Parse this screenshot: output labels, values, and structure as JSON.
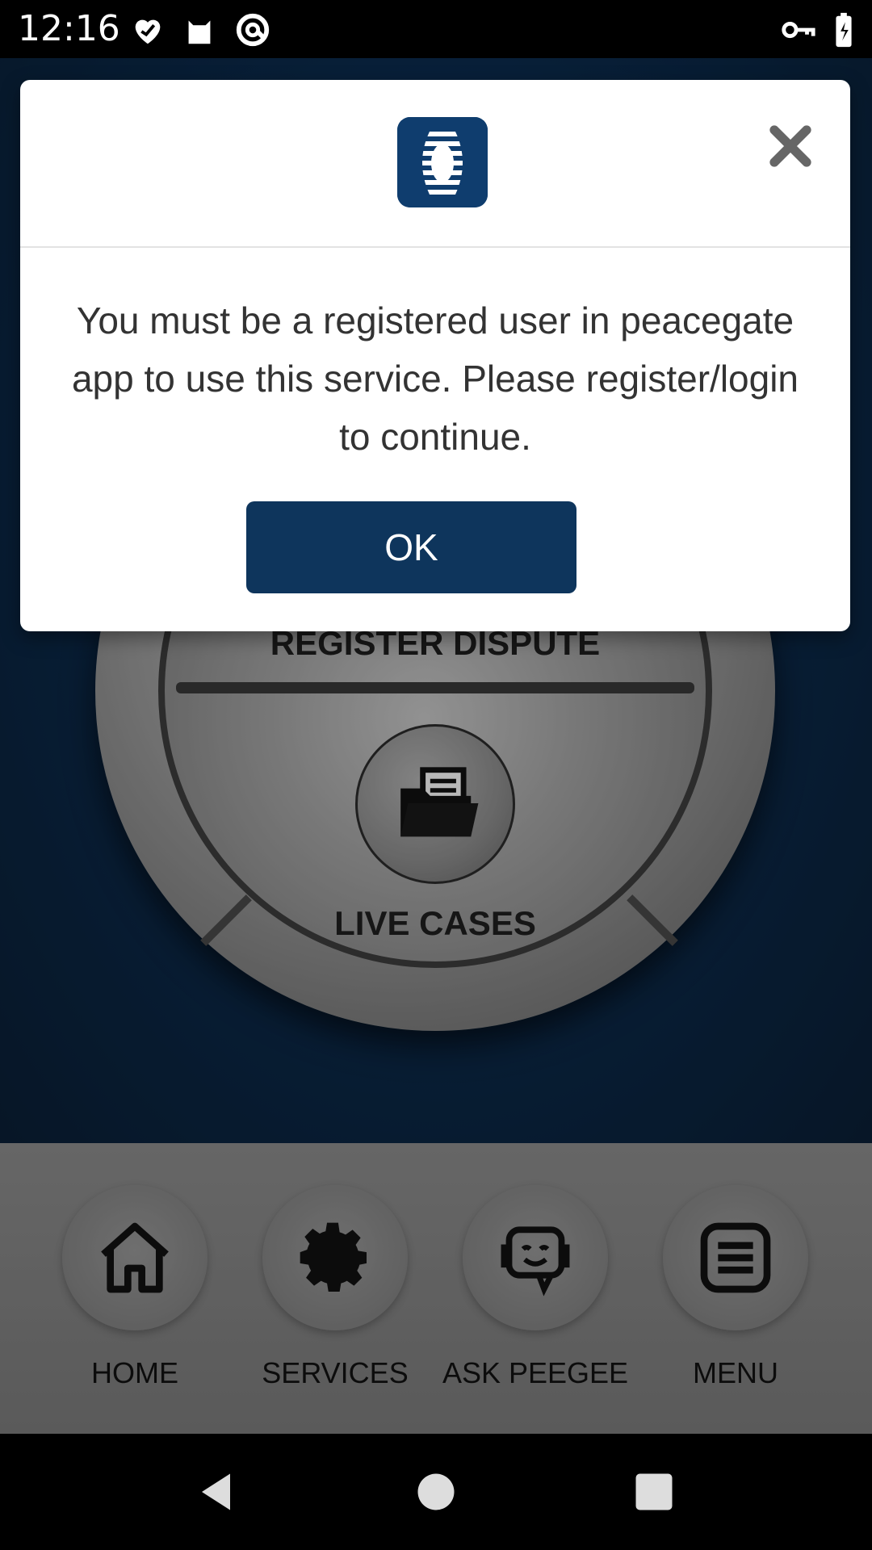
{
  "status_bar": {
    "time": "12:16",
    "left_icons": [
      "heart-notification-icon",
      "cat-notification-icon",
      "at-sign-notification-icon"
    ],
    "right_icons": [
      "vpn-key-icon",
      "battery-charging-icon"
    ]
  },
  "wheel": {
    "top_label": "REGISTER DISPUTE",
    "center_label": "LIVE CASES",
    "center_icon": "folder-icon"
  },
  "bottom_nav": {
    "items": [
      {
        "label": "HOME",
        "icon": "home-icon"
      },
      {
        "label": "SERVICES",
        "icon": "gear-icon"
      },
      {
        "label": "ASK PEEGEE",
        "icon": "chatbot-icon"
      },
      {
        "label": "MENU",
        "icon": "menu-icon"
      }
    ]
  },
  "dialog": {
    "logo_icon": "peacegate-logo",
    "message": "You must be a registered user in peacegate app to use this service. Please register/login to continue.",
    "ok_label": "OK",
    "close_icon": "close-icon"
  },
  "system_nav": {
    "buttons": [
      "back-icon",
      "home-circle-icon",
      "recents-icon"
    ]
  },
  "colors": {
    "primary": "#0e355c",
    "background": "#0c2c4f",
    "nav_bar": "#858585"
  }
}
